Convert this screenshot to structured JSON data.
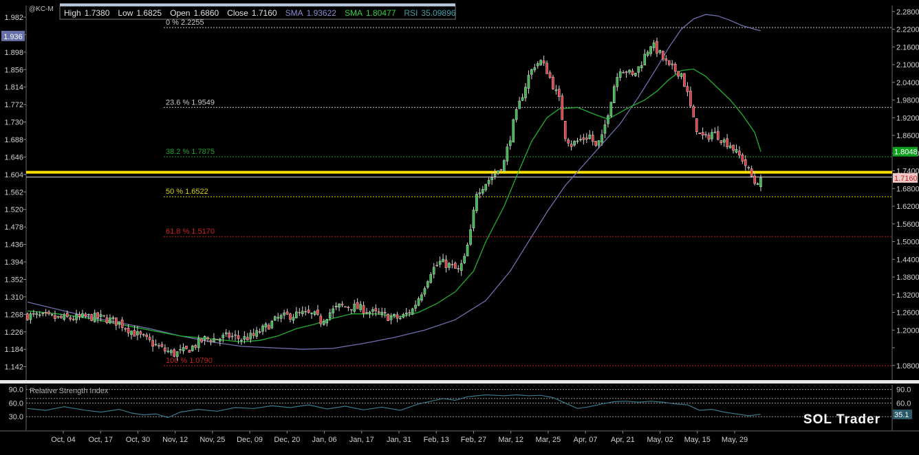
{
  "symbol": "@KC-M",
  "watermark": "SOL Trader",
  "info_bar": {
    "high": "1.7380",
    "low": "1.6825",
    "open": "1.6860",
    "close": "1.7160",
    "sma1": "1.93622",
    "sma2": "1.80477",
    "rsi": "35.09896",
    "labels": {
      "high": "High",
      "low": "Low",
      "open": "Open",
      "close": "Close",
      "sma": "SMA",
      "rsi": "RSI"
    }
  },
  "colors": {
    "background": "#000000",
    "up_candle": "#39b54a",
    "down_candle": "#e0393e",
    "sma_slow": "#7070b0",
    "sma_fast": "#20b030",
    "highlight_line": "#ffe000",
    "rsi_line": "#3a7a8a",
    "fib_0": "#c8c8c8",
    "fib_236": "#c8c8c8",
    "fib_382": "#20a030",
    "fib_50": "#d4d400",
    "fib_618": "#d02020",
    "fib_100": "#c02020"
  },
  "chart_data": [
    {
      "type": "candlestick",
      "title": "",
      "x_dates": [
        "Oct, 04",
        "Oct, 17",
        "Oct, 30",
        "Nov, 12",
        "Nov, 25",
        "Dec, 09",
        "Dec, 20",
        "Jan, 06",
        "Jan, 17",
        "Jan, 31",
        "Feb, 13",
        "Feb, 27",
        "Mar, 12",
        "Mar, 25",
        "Apr, 07",
        "Apr, 21",
        "May, 02",
        "May, 15",
        "May, 29"
      ],
      "left_axis": {
        "ylim": [
          1.11,
          2.01
        ],
        "ticks": [
          1.982,
          1.94,
          1.898,
          1.856,
          1.814,
          1.772,
          1.73,
          1.688,
          1.646,
          1.604,
          1.562,
          1.52,
          1.478,
          1.436,
          1.394,
          1.352,
          1.31,
          1.268,
          1.226,
          1.184,
          1.142
        ],
        "tick_labels": [
          "1.982",
          "",
          "1.898",
          "1.856",
          "1.814",
          "1.772",
          "1.730",
          "1.688",
          "1.646",
          "1.604",
          "1.562",
          "1.520",
          "1.478",
          "1.436",
          "1.394",
          "1.352",
          "1.310",
          "1.268",
          "1.226",
          "1.184",
          "1.142"
        ],
        "highlight_label": "1.936"
      },
      "right_axis": {
        "ylim": [
          1.0305,
          2.3005
        ],
        "ticks": [
          2.28,
          2.22,
          2.16,
          2.1,
          2.04,
          1.98,
          1.92,
          1.86,
          1.8,
          1.74,
          1.68,
          1.62,
          1.56,
          1.5,
          1.44,
          1.38,
          1.32,
          1.26,
          1.2,
          1.14,
          1.08
        ],
        "tick_labels": [
          "2.2800",
          "2.2200",
          "2.1600",
          "2.1000",
          "2.0400",
          "1.9800",
          "1.9200",
          "1.8600",
          "1.8000",
          "1.7400",
          "1.6800",
          "1.6200",
          "1.5600",
          "1.5000",
          "1.4400",
          "1.3800",
          "1.3200",
          "1.2600",
          "1.2000",
          "",
          "1.0800"
        ],
        "price_tags": [
          {
            "value": 1.8048,
            "label": "1.8048"
          },
          {
            "value": 1.716,
            "label": "1.7160"
          }
        ]
      },
      "highlight_level": 1.735,
      "fibonacci": [
        {
          "pct": "0 %",
          "value": 2.2255,
          "text": "0 %  2.2255"
        },
        {
          "pct": "23.6 %",
          "value": 1.9549,
          "text": "23.6 %  1.9549"
        },
        {
          "pct": "38.2 %",
          "value": 1.7875,
          "text": "38.2 %  1.7875"
        },
        {
          "pct": "50 %",
          "value": 1.6522,
          "text": "50 %  1.6522"
        },
        {
          "pct": "61.8 %",
          "value": 1.517,
          "text": "61.8 %  1.5170"
        },
        {
          "pct": "100 %",
          "value": 1.079,
          "text": "100 %  1.0790"
        }
      ],
      "ohlc_anchors": [
        [
          0,
          1.25
        ],
        [
          5,
          1.245
        ],
        [
          10,
          1.24
        ],
        [
          15,
          1.24
        ],
        [
          20,
          1.245
        ],
        [
          25,
          1.24
        ],
        [
          30,
          1.225
        ],
        [
          35,
          1.19
        ],
        [
          40,
          1.16
        ],
        [
          45,
          1.13
        ],
        [
          48,
          1.12
        ],
        [
          52,
          1.13
        ],
        [
          55,
          1.15
        ],
        [
          58,
          1.17
        ],
        [
          62,
          1.17
        ],
        [
          66,
          1.18
        ],
        [
          70,
          1.17
        ],
        [
          74,
          1.18
        ],
        [
          78,
          1.21
        ],
        [
          82,
          1.24
        ],
        [
          86,
          1.25
        ],
        [
          90,
          1.255
        ],
        [
          94,
          1.25
        ],
        [
          96,
          1.23
        ],
        [
          99,
          1.26
        ],
        [
          102,
          1.28
        ],
        [
          106,
          1.28
        ],
        [
          110,
          1.27
        ],
        [
          114,
          1.255
        ],
        [
          118,
          1.245
        ],
        [
          122,
          1.24
        ],
        [
          126,
          1.27
        ],
        [
          129,
          1.33
        ],
        [
          132,
          1.4
        ],
        [
          135,
          1.43
        ],
        [
          138,
          1.42
        ],
        [
          141,
          1.4
        ],
        [
          143,
          1.44
        ],
        [
          145,
          1.53
        ],
        [
          147,
          1.67
        ],
        [
          150,
          1.7
        ],
        [
          153,
          1.73
        ],
        [
          156,
          1.77
        ],
        [
          159,
          1.9
        ],
        [
          162,
          2.0
        ],
        [
          164,
          2.06
        ],
        [
          166,
          2.1
        ],
        [
          168,
          2.11
        ],
        [
          170,
          2.08
        ],
        [
          172,
          2.03
        ],
        [
          174,
          1.98
        ],
        [
          176,
          1.86
        ],
        [
          178,
          1.83
        ],
        [
          180,
          1.84
        ],
        [
          182,
          1.85
        ],
        [
          184,
          1.86
        ],
        [
          186,
          1.82
        ],
        [
          188,
          1.85
        ],
        [
          190,
          1.94
        ],
        [
          192,
          2.03
        ],
        [
          194,
          2.09
        ],
        [
          196,
          2.08
        ],
        [
          198,
          2.06
        ],
        [
          200,
          2.09
        ],
        [
          202,
          2.13
        ],
        [
          204,
          2.17
        ],
        [
          206,
          2.15
        ],
        [
          208,
          2.12
        ],
        [
          210,
          2.09
        ],
        [
          212,
          2.08
        ],
        [
          214,
          2.07
        ],
        [
          216,
          2.0
        ],
        [
          218,
          1.91
        ],
        [
          220,
          1.86
        ],
        [
          222,
          1.85
        ],
        [
          224,
          1.87
        ],
        [
          226,
          1.86
        ],
        [
          228,
          1.84
        ],
        [
          230,
          1.83
        ],
        [
          232,
          1.8
        ],
        [
          234,
          1.78
        ],
        [
          236,
          1.74
        ],
        [
          238,
          1.7
        ],
        [
          240,
          1.716
        ]
      ],
      "series": [
        {
          "name": "SMA",
          "value": "1.93622",
          "points": [
            [
              0,
              1.295
            ],
            [
              10,
              1.27
            ],
            [
              20,
              1.245
            ],
            [
              30,
              1.225
            ],
            [
              40,
              1.205
            ],
            [
              50,
              1.18
            ],
            [
              60,
              1.16
            ],
            [
              70,
              1.145
            ],
            [
              80,
              1.14
            ],
            [
              90,
              1.135
            ],
            [
              100,
              1.138
            ],
            [
              110,
              1.155
            ],
            [
              120,
              1.175
            ],
            [
              130,
              1.2
            ],
            [
              140,
              1.235
            ],
            [
              150,
              1.3
            ],
            [
              158,
              1.4
            ],
            [
              164,
              1.5
            ],
            [
              170,
              1.6
            ],
            [
              176,
              1.69
            ],
            [
              182,
              1.76
            ],
            [
              188,
              1.83
            ],
            [
              194,
              1.9
            ],
            [
              200,
              1.99
            ],
            [
              206,
              2.09
            ],
            [
              210,
              2.16
            ],
            [
              214,
              2.22
            ],
            [
              218,
              2.255
            ],
            [
              222,
              2.27
            ],
            [
              226,
              2.265
            ],
            [
              230,
              2.25
            ],
            [
              234,
              2.232
            ],
            [
              238,
              2.22
            ],
            [
              240,
              2.215
            ]
          ]
        },
        {
          "name": "SMA",
          "value": "1.80477",
          "points": [
            [
              0,
              1.265
            ],
            [
              10,
              1.255
            ],
            [
              20,
              1.24
            ],
            [
              30,
              1.22
            ],
            [
              40,
              1.2
            ],
            [
              50,
              1.18
            ],
            [
              60,
              1.17
            ],
            [
              70,
              1.16
            ],
            [
              76,
              1.165
            ],
            [
              82,
              1.18
            ],
            [
              88,
              1.205
            ],
            [
              94,
              1.22
            ],
            [
              100,
              1.24
            ],
            [
              106,
              1.255
            ],
            [
              114,
              1.255
            ],
            [
              122,
              1.245
            ],
            [
              128,
              1.26
            ],
            [
              134,
              1.29
            ],
            [
              140,
              1.33
            ],
            [
              146,
              1.4
            ],
            [
              150,
              1.5
            ],
            [
              156,
              1.62
            ],
            [
              160,
              1.72
            ],
            [
              165,
              1.84
            ],
            [
              170,
              1.92
            ],
            [
              174,
              1.95
            ],
            [
              180,
              1.955
            ],
            [
              186,
              1.93
            ],
            [
              190,
              1.915
            ],
            [
              196,
              1.95
            ],
            [
              202,
              1.98
            ],
            [
              206,
              2.01
            ],
            [
              210,
              2.05
            ],
            [
              214,
              2.08
            ],
            [
              218,
              2.085
            ],
            [
              222,
              2.06
            ],
            [
              226,
              2.02
            ],
            [
              230,
              1.98
            ],
            [
              234,
              1.93
            ],
            [
              238,
              1.87
            ],
            [
              240,
              1.805
            ]
          ]
        }
      ]
    },
    {
      "type": "line",
      "title": "Relative Strength Index",
      "ylim": [
        0,
        100
      ],
      "left_ticks": [
        "90.0",
        "60.0",
        "30.0"
      ],
      "right_ticks": [
        "90.0",
        "60.0",
        "30.0"
      ],
      "reference_levels": [
        90,
        70,
        60,
        30
      ],
      "last_label": "35.1",
      "series": [
        {
          "name": "RSI",
          "value": "35.09896",
          "points": [
            [
              0,
              48
            ],
            [
              6,
              44
            ],
            [
              12,
              52
            ],
            [
              18,
              45
            ],
            [
              24,
              40
            ],
            [
              30,
              46
            ],
            [
              34,
              38
            ],
            [
              38,
              34
            ],
            [
              42,
              36
            ],
            [
              46,
              28
            ],
            [
              50,
              40
            ],
            [
              56,
              46
            ],
            [
              62,
              42
            ],
            [
              68,
              50
            ],
            [
              74,
              48
            ],
            [
              80,
              54
            ],
            [
              86,
              50
            ],
            [
              92,
              56
            ],
            [
              98,
              47
            ],
            [
              104,
              53
            ],
            [
              110,
              45
            ],
            [
              116,
              51
            ],
            [
              122,
              44
            ],
            [
              128,
              58
            ],
            [
              132,
              64
            ],
            [
              136,
              70
            ],
            [
              140,
              66
            ],
            [
              144,
              74
            ],
            [
              150,
              78
            ],
            [
              156,
              76
            ],
            [
              160,
              78
            ],
            [
              164,
              76
            ],
            [
              168,
              77
            ],
            [
              172,
              72
            ],
            [
              176,
              60
            ],
            [
              180,
              48
            ],
            [
              184,
              52
            ],
            [
              188,
              58
            ],
            [
              192,
              63
            ],
            [
              196,
              64
            ],
            [
              200,
              62
            ],
            [
              204,
              64
            ],
            [
              208,
              62
            ],
            [
              212,
              58
            ],
            [
              216,
              56
            ],
            [
              220,
              44
            ],
            [
              224,
              46
            ],
            [
              228,
              40
            ],
            [
              232,
              36
            ],
            [
              236,
              32
            ],
            [
              240,
              35.1
            ]
          ]
        }
      ]
    }
  ]
}
